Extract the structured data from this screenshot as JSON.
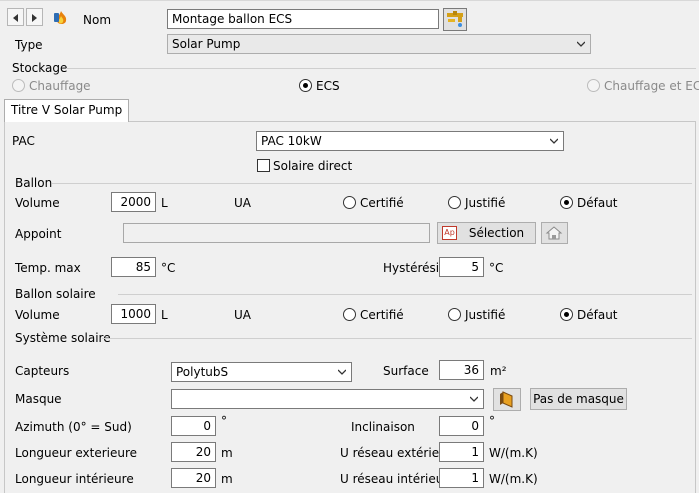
{
  "header": {
    "nom_label": "Nom",
    "nom_value": "Montage ballon ECS",
    "type_label": "Type",
    "type_value": "Solar Pump"
  },
  "stockage": {
    "label": "Stockage",
    "options": [
      "Chauffage",
      "ECS",
      "Chauffage et ECS"
    ],
    "selected": "ECS"
  },
  "tab": {
    "label": "Titre V Solar Pump"
  },
  "pac": {
    "label": "PAC",
    "value": "PAC 10kW",
    "solaire_direct_label": "Solaire direct",
    "solaire_direct_checked": false
  },
  "ballon": {
    "section": "Ballon",
    "volume_label": "Volume",
    "volume_value": "2000",
    "volume_unit": "L",
    "ua_label": "UA",
    "ua_options": [
      "Certifié",
      "Justifié",
      "Défaut"
    ],
    "ua_selected": "Défaut",
    "appoint_label": "Appoint",
    "appoint_value": "",
    "selection_label": "Sélection",
    "selection_icon_text": "Ap",
    "temp_label": "Temp. max",
    "temp_value": "85",
    "temp_unit": "°C",
    "hyst_label": "Hystérésis",
    "hyst_value": "5",
    "hyst_unit": "°C"
  },
  "ballon_solaire": {
    "section": "Ballon solaire",
    "volume_label": "Volume",
    "volume_value": "1000",
    "volume_unit": "L",
    "ua_label": "UA",
    "ua_options": [
      "Certifié",
      "Justifié",
      "Défaut"
    ],
    "ua_selected": "Défaut"
  },
  "systeme_solaire": {
    "section": "Système solaire",
    "capteurs_label": "Capteurs",
    "capteurs_value": "PolytubS",
    "surface_label": "Surface",
    "surface_value": "36",
    "surface_unit": "m²",
    "masque_label": "Masque",
    "masque_value": "",
    "pas_de_masque_label": "Pas de masque",
    "azimuth_label": "Azimuth (0° = Sud)",
    "azimuth_value": "0",
    "azimuth_unit": "°",
    "inclinaison_label": "Inclinaison",
    "inclinaison_value": "0",
    "inclinaison_unit": "°",
    "long_ext_label": "Longueur exterieure",
    "long_ext_value": "20",
    "long_ext_unit": "m",
    "u_ext_label": "U réseau extérieur",
    "u_ext_value": "1",
    "u_ext_unit": "W/(m.K)",
    "long_int_label": "Longueur intérieure",
    "long_int_value": "20",
    "long_int_unit": "m",
    "u_int_label": "U réseau intérieur",
    "u_int_value": "1",
    "u_int_unit": "W/(m.K)"
  },
  "colors": {
    "selection_icon": "#c0392b",
    "navtri": "#333333"
  },
  "icons": [
    "nav-prev-icon",
    "nav-next-icon",
    "tap-flame-icon",
    "faucet-icon",
    "chevron-down-icon",
    "home-icon",
    "masque-icon"
  ]
}
